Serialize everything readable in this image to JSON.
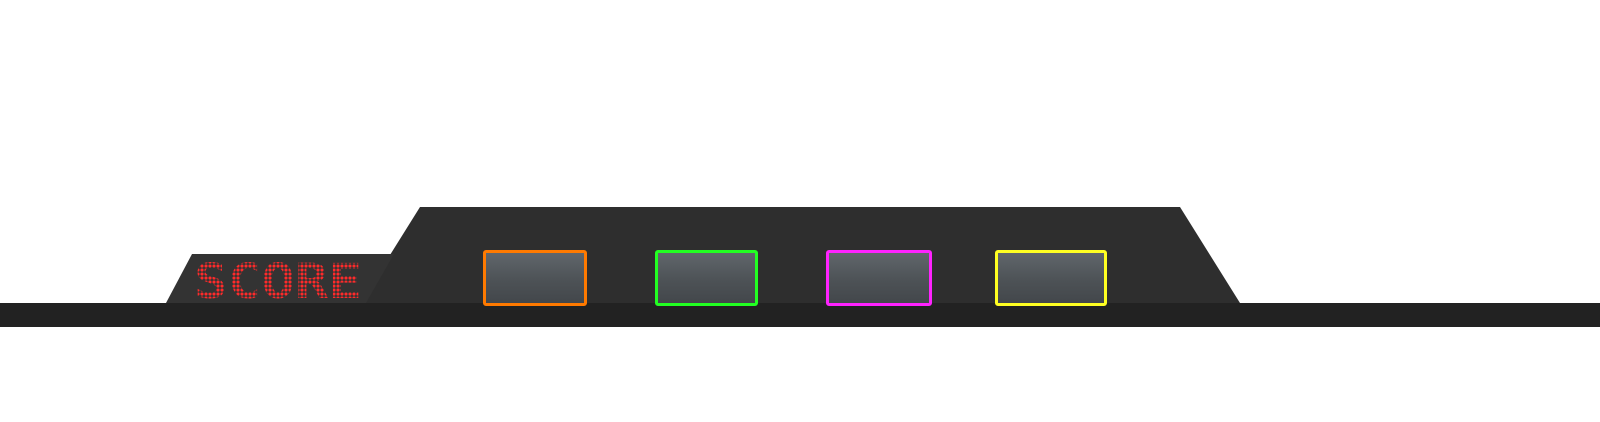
{
  "score_display": {
    "label": "SCORE",
    "color": "#ff2a2a",
    "style": "led-dot-matrix"
  },
  "console": {
    "body_color": "#222222",
    "top_panel_color": "#2e2e2e",
    "score_panel_color": "#333333"
  },
  "pads": [
    {
      "name": "orange",
      "border_color": "#ff7a00"
    },
    {
      "name": "green",
      "border_color": "#22ff22"
    },
    {
      "name": "magenta",
      "border_color": "#ff22ff"
    },
    {
      "name": "yellow",
      "border_color": "#ffff22"
    }
  ]
}
